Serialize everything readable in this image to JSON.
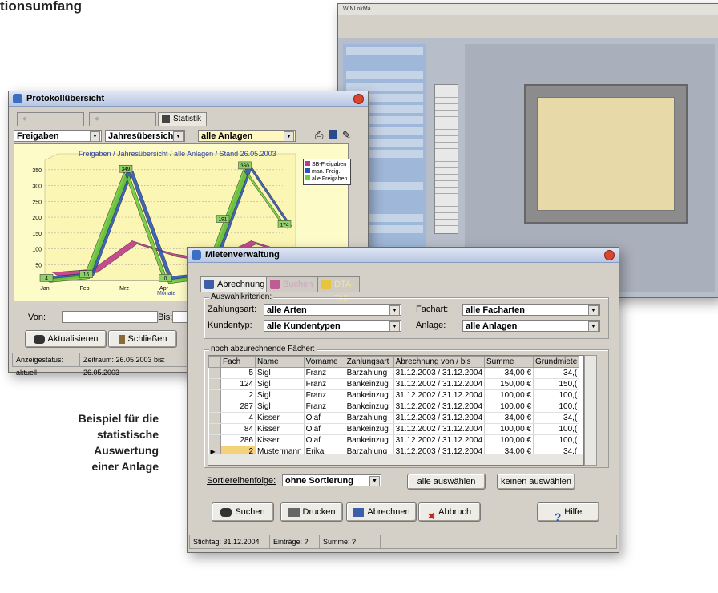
{
  "headline": "tionsumfang",
  "caption": [
    "Beispiel für die",
    "statistische",
    "Auswertung",
    "einer Anlage"
  ],
  "back_window": {
    "title": "WINLokMa"
  },
  "stats_window": {
    "title": "Protokollübersicht",
    "tab_active": "Statistik",
    "filter_1": "Freigaben",
    "filter_2": "Jahresübersicht",
    "filter_3": "alle Anlagen",
    "chart_title": "Freigaben / Jahresübersicht / alle Anlagen / Stand 26.05.2003",
    "legend": [
      "SB-Freigaben",
      "man. Freig.",
      "alle Freigaben"
    ],
    "xaxis_title": "Monate",
    "from_label": "Von:",
    "to_label": "Bis:",
    "refresh_label": "Aktualisieren",
    "close_label": "Schließen",
    "status_1": "Anzeigestatus: aktuell",
    "status_2": "Zeitraum: 26.05.2003 bis: 26.05.2003"
  },
  "chart_data": {
    "type": "line",
    "title": "Freigaben / Jahresübersicht / alle Anlagen / Stand 26.05.2003",
    "xlabel": "Monate",
    "ylabel": "",
    "categories": [
      "Jan",
      "Feb",
      "Mrz",
      "Apr",
      "Mai",
      "Jun",
      "Jul"
    ],
    "yticks": [
      50,
      100,
      150,
      200,
      250,
      300,
      350
    ],
    "data_labels": [
      "4",
      "16",
      "349",
      "0",
      "17",
      "191",
      "360",
      "174"
    ],
    "series": [
      {
        "name": "SB-Freigaben",
        "color": "#c03a8c",
        "values": [
          10,
          20,
          110,
          70,
          50,
          110,
          70
        ]
      },
      {
        "name": "man. Freig.",
        "color": "#2b55b8",
        "values": [
          4,
          16,
          349,
          4,
          17,
          360,
          174
        ]
      },
      {
        "name": "alle Freigaben",
        "color": "#6fcb3a",
        "values": [
          4,
          16,
          345,
          0,
          17,
          350,
          174
        ]
      }
    ],
    "ylim": [
      0,
      380
    ],
    "grid": true,
    "legend_position": "top-right"
  },
  "front_window": {
    "title": "Mietenverwaltung",
    "tabs": [
      "Abrechnung",
      "Buchen",
      "DTA-Teil"
    ],
    "criteria_group": "Auswahlkriterien:",
    "zahlungsart_label": "Zahlungsart:",
    "zahlungsart_value": "alle Arten",
    "kundentyp_label": "Kundentyp:",
    "kundentyp_value": "alle Kundentypen",
    "fachart_label": "Fachart:",
    "fachart_value": "alle Facharten",
    "anlage_label": "Anlage:",
    "anlage_value": "alle Anlagen",
    "grid_group": "noch abzurechnende Fächer:",
    "columns": [
      "Fach",
      "Name",
      "Vorname",
      "Zahlungsart",
      "Abrechnung von / bis",
      "Summe",
      "Grundmiete"
    ],
    "rows": [
      [
        "5",
        "Sigl",
        "Franz",
        "Barzahlung",
        "31.12.2003 / 31.12.2004",
        "34,00 €",
        "34,("
      ],
      [
        "124",
        "Sigl",
        "Franz",
        "Bankeinzug",
        "31.12.2002 / 31.12.2004",
        "150,00 €",
        "150,("
      ],
      [
        "2",
        "Sigl",
        "Franz",
        "Bankeinzug",
        "31.12.2002 / 31.12.2004",
        "100,00 €",
        "100,("
      ],
      [
        "287",
        "Sigl",
        "Franz",
        "Bankeinzug",
        "31.12.2002 / 31.12.2004",
        "100,00 €",
        "100,("
      ],
      [
        "4",
        "Kisser",
        "Olaf",
        "Barzahlung",
        "31.12.2003 / 31.12.2004",
        "34,00 €",
        "34,("
      ],
      [
        "84",
        "Kisser",
        "Olaf",
        "Bankeinzug",
        "31.12.2002 / 31.12.2004",
        "100,00 €",
        "100,("
      ],
      [
        "286",
        "Kisser",
        "Olaf",
        "Bankeinzug",
        "31.12.2002 / 31.12.2004",
        "100,00 €",
        "100,("
      ],
      [
        "2",
        "Mustermann",
        "Erika",
        "Barzahlung",
        "31.12.2003 / 31.12.2004",
        "34,00 €",
        "34,("
      ]
    ],
    "sort_label": "Sortiereihenfolge:",
    "sort_value": "ohne Sortierung",
    "select_all_label": "alle auswählen",
    "select_none_label": "keinen auswählen",
    "search_label": "Suchen",
    "print_label": "Drucken",
    "bill_label": "Abrechnen",
    "cancel_label": "Abbruch",
    "help_label": "Hilfe",
    "status": [
      "Stichtag: 31.12.2004",
      "Einträge: ?",
      "Summe: ?"
    ]
  }
}
